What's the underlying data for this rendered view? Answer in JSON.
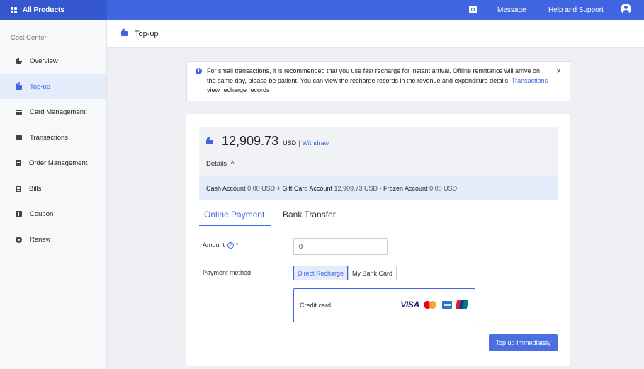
{
  "topbar": {
    "brand": "All Products",
    "message": "Message",
    "help": "Help and Support"
  },
  "sidebar": {
    "title": "Cost Center",
    "items": [
      {
        "label": "Overview",
        "icon": "pie-chart-icon"
      },
      {
        "label": "Top-up",
        "icon": "wallet-icon",
        "active": true
      },
      {
        "label": "Card Management",
        "icon": "card-icon"
      },
      {
        "label": "Transactions",
        "icon": "card-icon"
      },
      {
        "label": "Order Management",
        "icon": "document-icon"
      },
      {
        "label": "Bills",
        "icon": "bill-icon"
      },
      {
        "label": "Coupon",
        "icon": "coupon-icon"
      },
      {
        "label": "Renew",
        "icon": "renew-icon"
      }
    ]
  },
  "page": {
    "title": "Top-up"
  },
  "notice": {
    "text_before": "For small transactions, it is recommended that you use fast recharge for instant arrival. Offline remittance will arrive on the same day, please be patient. You can view the recharge records in the revenue and expenditure details.",
    "link": "Transactions",
    "text_after": "view recharge records"
  },
  "balance": {
    "amount": "12,909.73",
    "currency": "USD",
    "separator": "|",
    "withdraw": "Withdraw",
    "details_label": "Details",
    "cash_label": "Cash Account",
    "cash_value": "0.00 USD",
    "plus": "+",
    "gift_label": "Gift Card Account",
    "gift_value": "12,909.73 USD",
    "minus": "-",
    "frozen_label": "Frozen Account",
    "frozen_value": "0.00 USD"
  },
  "tabs": {
    "online": "Online Payment",
    "bank": "Bank Transfer"
  },
  "form": {
    "amount_label": "Amount",
    "amount_value": "0",
    "required_mark": "*",
    "payment_label": "Payment method",
    "direct": "Direct Recharge",
    "my_card": "My Bank Card",
    "credit_card": "Credit card",
    "visa": "VISA",
    "submit": "Top up Immediately"
  },
  "colors": {
    "accent": "#3f66e0",
    "topbar": "#3f66e0",
    "active_bg": "#e4ebfb"
  }
}
